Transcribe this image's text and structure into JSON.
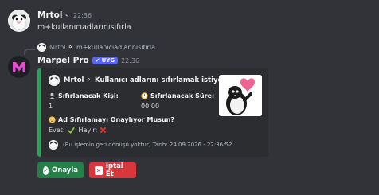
{
  "message1": {
    "author": "Mrtol",
    "time": "22:36",
    "text": "m+kullanıcıadlarınısıfırla"
  },
  "reply": {
    "author": "Mrtol",
    "text": "m+kullanıcıadlarınısıfırla"
  },
  "message2": {
    "author": "Marpel Pro",
    "badge": "UYG",
    "time": "22:36"
  },
  "embed": {
    "accent_color": "#23a559",
    "title": "Mrtol",
    "title_text": "Kullanıcı adlarını sıfırlamak istiyor musun?",
    "field1_name": "Sıfırlanacak Kişi:",
    "field1_value": "1",
    "field2_name": "Sıfırlanacak Süre:",
    "field2_value": "00:00",
    "question": "Ad Sıfırlamayı Onaylıyor Musun?",
    "yes_label": "Evet:",
    "no_label": "Hayır:",
    "footer": "(Bu işlemin geri dönüşü yoktur) Tarih: 24.09.2026 - 22:36:52"
  },
  "buttons": {
    "confirm": "Onayla",
    "cancel": "İptal Et"
  },
  "colors": {
    "background": "#313338",
    "embed_bg": "#2b2d31",
    "confirm": "#248046",
    "cancel": "#da373c",
    "badge": "#5865f2"
  }
}
